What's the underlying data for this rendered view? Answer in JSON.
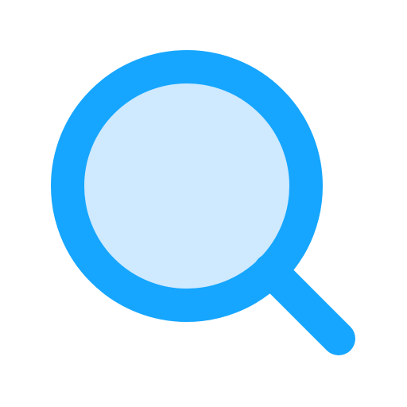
{
  "icon": {
    "name": "search-icon",
    "colors": {
      "stroke": "#16A6FF",
      "lens_fill": "#CFE9FF",
      "background": "#FFFFFF"
    }
  }
}
